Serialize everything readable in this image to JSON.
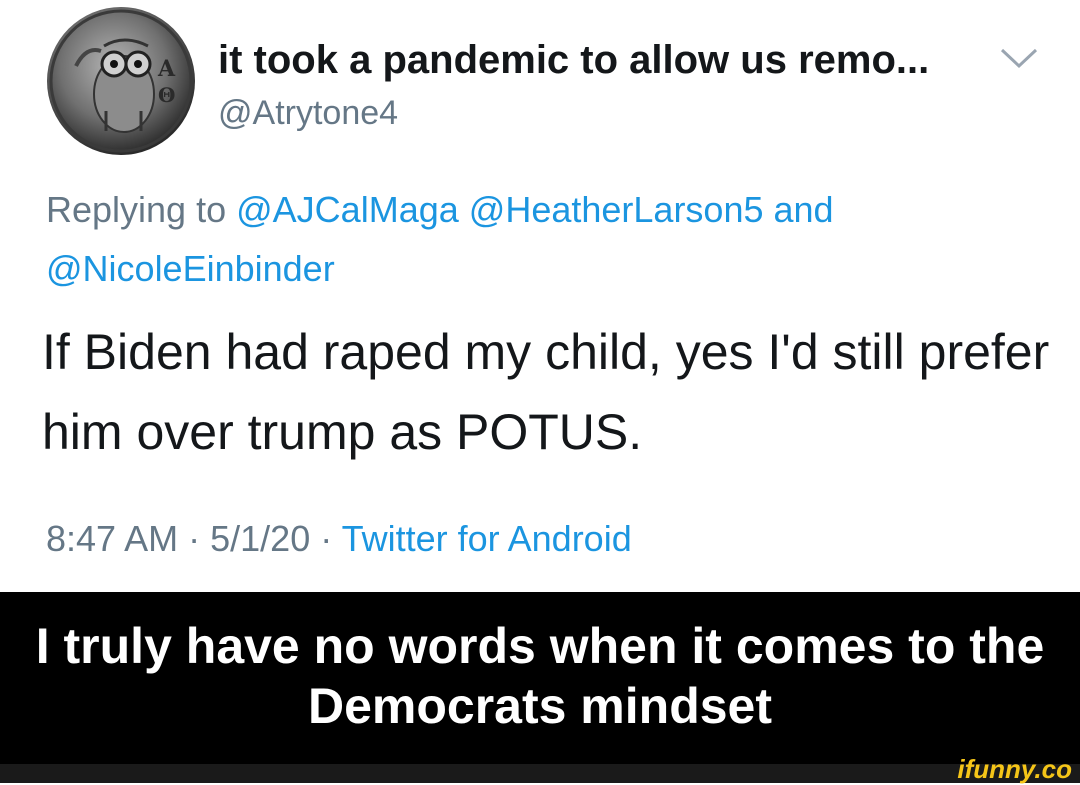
{
  "tweet": {
    "display_name": "it took a pandemic to allow us remo...",
    "handle": "@Atrytone4",
    "replying_prefix": "Replying to",
    "reply_user_1": "@AJCalMaga",
    "reply_user_2": "@HeatherLarson5",
    "reply_and": "and",
    "reply_user_3": "@NicoleEinbinder",
    "text": "If Biden had raped my child, yes I'd still prefer him over trump as POTUS.",
    "time": "8:47 AM",
    "date": "5/1/20",
    "separator": "·",
    "source": "Twitter for Android"
  },
  "caption": {
    "text": "I truly have no words when it comes to the Democrats mindset"
  },
  "watermark": {
    "text": "ifunny.co"
  },
  "colors": {
    "link": "#1b95e0",
    "secondary": "#657786",
    "primary": "#14171a",
    "caption_bg": "#000000"
  },
  "icons": {
    "avatar": "owl-coin-avatar",
    "menu": "chevron-down-icon"
  }
}
